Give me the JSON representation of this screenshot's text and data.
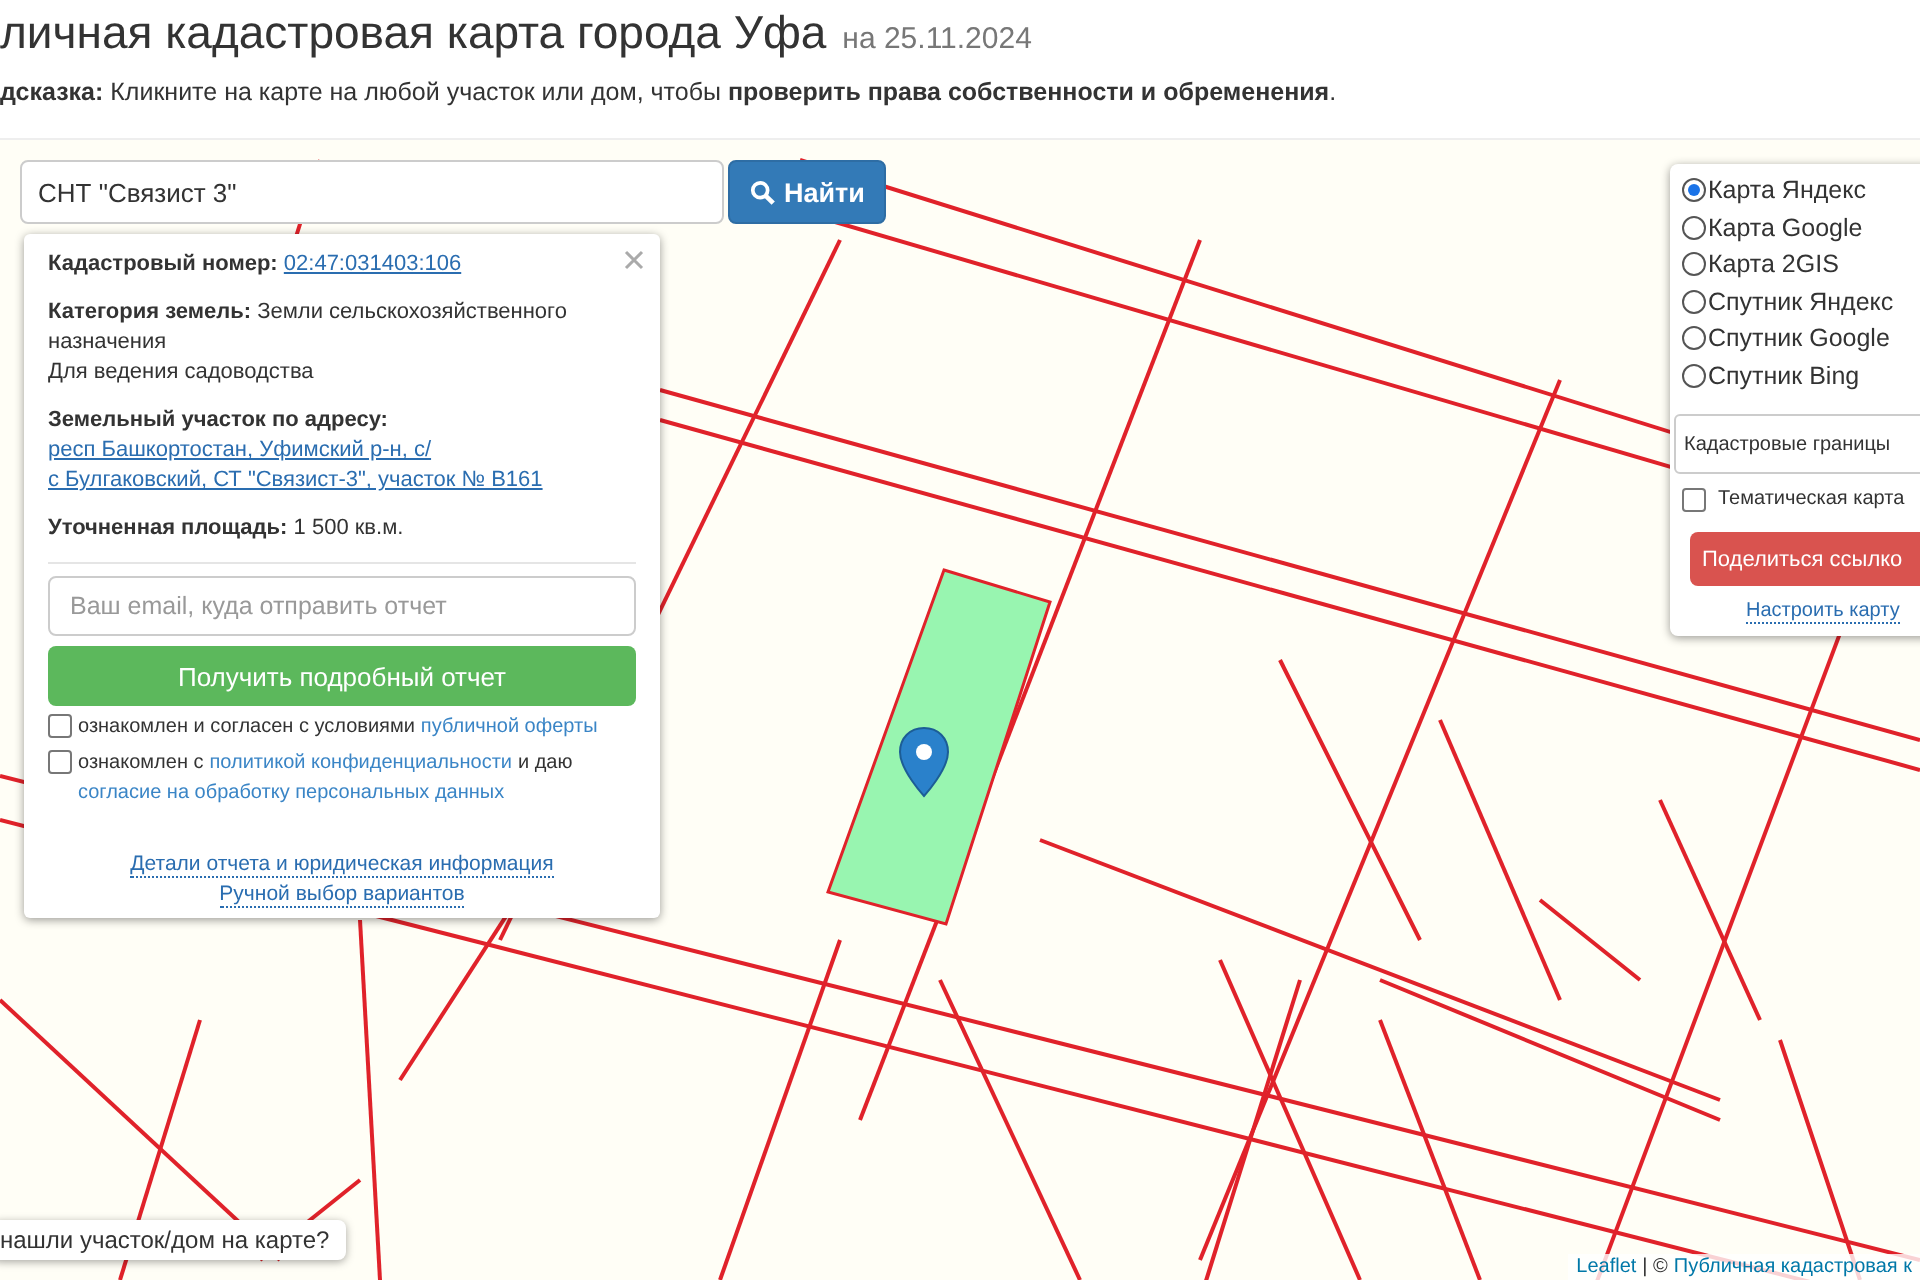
{
  "header": {
    "title": "личная кадастровая карта города Уфа",
    "date": "на 25.11.2024"
  },
  "hint": "**дсказка:** Кликните на карте на любой участок или дом, чтобы **проверить права собственности и обременения**.",
  "search": {
    "value": "СНТ \"Связист 3\"",
    "button": "Найти"
  },
  "popup": {
    "cadastral_label": "Кадастровый номер:",
    "cadastral_number": "02:47:031403:106",
    "category_label": "Категория земель:",
    "category": "Земли сельскохозяйственного назначения",
    "usage": "Для ведения садоводства",
    "address_label": "Земельный участок по адресу:",
    "address_lines": [
      "респ Башкортостан, Уфимский р-н, с/",
      "с Булгаковский, СТ \"Связист-3\", участок № В161"
    ],
    "area_label": "Уточненная площадь:",
    "area": "1 500 кв.м.",
    "email_placeholder": "Ваш email, куда отправить отчет",
    "report_button": "Получить подробный отчет",
    "consents": [
      {
        "checked": false,
        "parts": [
          {
            "kind": "text",
            "text": "ознакомлен и согласен с условиями"
          },
          {
            "kind": "link",
            "text": "публичной оферты"
          }
        ]
      },
      {
        "checked": false,
        "parts": [
          {
            "kind": "text",
            "text": "ознакомлен с"
          },
          {
            "kind": "link",
            "text": "политикой конфиденциальности"
          },
          {
            "kind": "text",
            "text": "и даю"
          },
          {
            "kind": "link",
            "text": "согласие на обработку персональных данных"
          }
        ]
      }
    ],
    "links": [
      "Детали отчета и юридическая информация",
      "Ручной выбор вариантов"
    ]
  },
  "layers": {
    "options": [
      {
        "label": "Карта Яндекс",
        "selected": true
      },
      {
        "label": "Карта Google",
        "selected": false
      },
      {
        "label": "Карта 2GIS",
        "selected": false
      },
      {
        "label": "Спутник Яндекс",
        "selected": false
      },
      {
        "label": "Спутник Google",
        "selected": false
      },
      {
        "label": "Спутник Bing",
        "selected": false
      }
    ],
    "overlay_select": "Кадастровые границы",
    "thematic": {
      "label": "Тематическая карта",
      "checked": false
    },
    "share_button": "Поделиться ссылко",
    "settings_link": "Настроить карту"
  },
  "help_tip": "нашли участок/дом на карте?",
  "attribution": {
    "leaflet": "Leaflet",
    "separator": "| ©",
    "source": "Публичная кадастровая к"
  }
}
